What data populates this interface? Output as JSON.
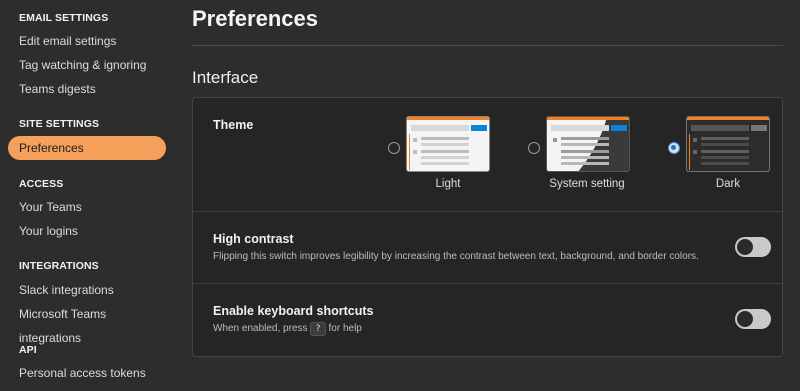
{
  "sidebar": {
    "sections": [
      {
        "title": "EMAIL SETTINGS",
        "items": [
          "Edit email settings",
          "Tag watching & ignoring",
          "Teams digests"
        ]
      },
      {
        "title": "SITE SETTINGS",
        "items": [
          "Preferences"
        ]
      },
      {
        "title": "ACCESS",
        "items": [
          "Your Teams",
          "Your logins"
        ]
      },
      {
        "title": "INTEGRATIONS",
        "items": [
          "Slack integrations",
          "Microsoft Teams integrations"
        ]
      },
      {
        "title": "API",
        "items": [
          "Personal access tokens"
        ]
      }
    ],
    "active_item": "Preferences"
  },
  "main": {
    "title": "Preferences",
    "section_title": "Interface",
    "theme": {
      "label": "Theme",
      "options": [
        "Light",
        "System setting",
        "Dark"
      ],
      "selected": "Dark"
    },
    "high_contrast": {
      "label": "High contrast",
      "description": "Flipping this switch improves legibility by increasing the contrast between text, background, and border colors.",
      "enabled": false
    },
    "keyboard_shortcuts": {
      "label": "Enable keyboard shortcuts",
      "desc_before": "When enabled, press",
      "key": "?",
      "desc_after": "for help",
      "enabled": false
    }
  },
  "colors": {
    "accent": "#f5a15c",
    "background": "#2d2d2d",
    "panel": "#252525",
    "radio_selected": "#2f6fb5"
  }
}
